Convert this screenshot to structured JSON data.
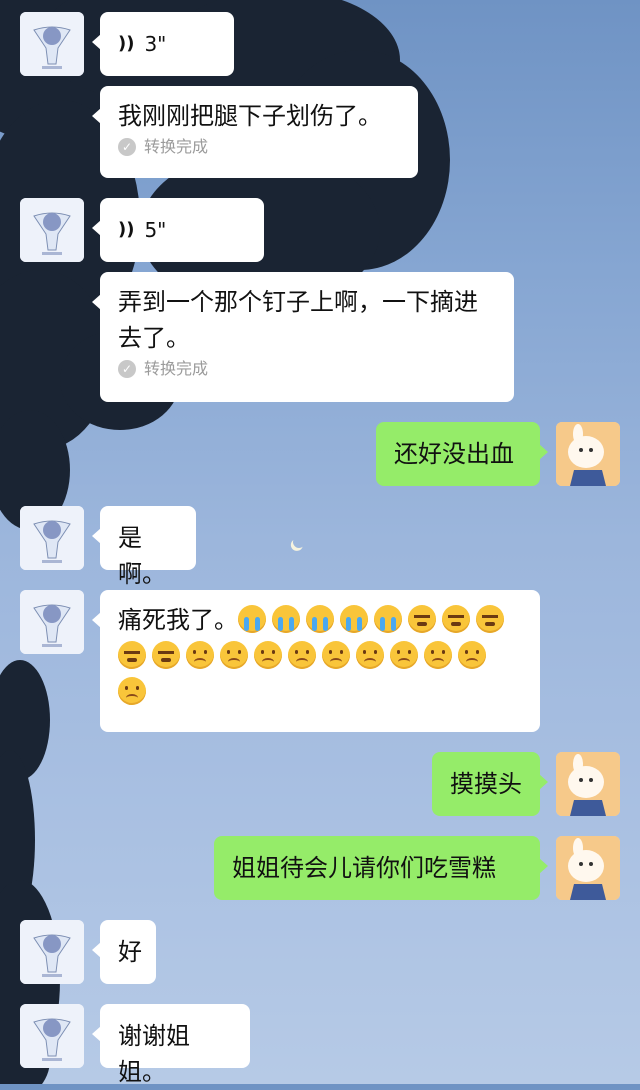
{
  "messages": [
    {
      "side": "left",
      "type": "voice",
      "duration": "3\""
    },
    {
      "side": "left",
      "type": "transcript",
      "text": "我刚刚把腿下子划伤了。",
      "status": "转换完成"
    },
    {
      "side": "left",
      "type": "voice",
      "duration": "5\""
    },
    {
      "side": "left",
      "type": "transcript",
      "text": "弄到一个那个钉子上啊，一下摘进去了。",
      "status": "转换完成"
    },
    {
      "side": "right",
      "type": "text",
      "text": "还好没出血"
    },
    {
      "side": "left",
      "type": "text",
      "text": "是啊。"
    },
    {
      "side": "left",
      "type": "text",
      "text": "痛死我了。",
      "emoji_seq": [
        "crying",
        "crying",
        "crying",
        "crying",
        "crying",
        "angry-crying",
        "angry-crying",
        "angry-crying",
        "angry-crying",
        "angry-crying",
        "sad",
        "sad",
        "sad",
        "sad",
        "sad",
        "sad",
        "sad",
        "sad",
        "sad",
        "sad"
      ]
    },
    {
      "side": "right",
      "type": "text",
      "text": "摸摸头"
    },
    {
      "side": "right",
      "type": "text",
      "text": "姐姐待会儿请你们吃雪糕"
    },
    {
      "side": "left",
      "type": "text",
      "text": "好"
    },
    {
      "side": "left",
      "type": "text",
      "text": "谢谢姐姐。"
    }
  ],
  "icons": {
    "voice": "voice-wave-icon",
    "check": "check-circle-icon",
    "moon": "moon-icon"
  },
  "colors": {
    "own_bubble": "#95ec69",
    "other_bubble": "#ffffff",
    "status_text": "#9b9b9b"
  }
}
